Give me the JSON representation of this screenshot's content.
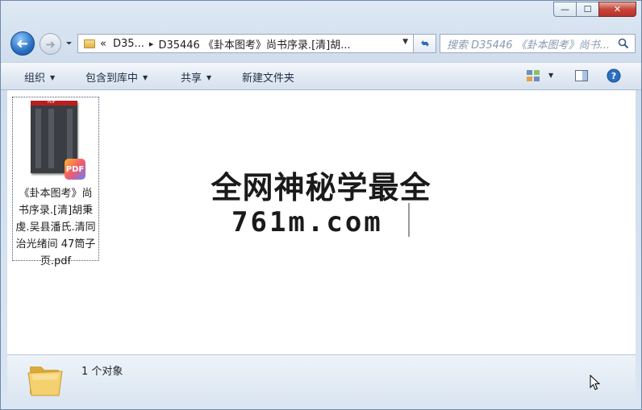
{
  "window": {
    "caption": {
      "minimize": "—",
      "maximize": "☐",
      "close": "✕"
    }
  },
  "navigation": {
    "back_glyph": "➜",
    "forward_glyph": "➜",
    "address": {
      "overflow": "«",
      "crumbs": [
        "D35...",
        "D35446 《卦本图考》尚书序录.[清]胡..."
      ]
    },
    "search": {
      "placeholder": "搜索 D35446 《卦本图考》尚书..."
    }
  },
  "toolbar": {
    "organize": "组织",
    "include_in_library": "包含到库中",
    "share": "共享",
    "new_folder": "新建文件夹"
  },
  "files": [
    {
      "name": "《卦本图考》尚书序录.[清]胡秉虔.吴县潘氏.清同治光绪间 47筒子页.pdf",
      "thumbnail_label": "PDF",
      "badge": "PDF"
    }
  ],
  "watermark": {
    "line1": "全网神秘学最全",
    "line2": "761m.com"
  },
  "status": {
    "count_text": "1 个对象"
  },
  "colors": {
    "accent": "#2a6fc2",
    "close_button": "#c7453a",
    "pdf_red": "#b91f1f"
  }
}
